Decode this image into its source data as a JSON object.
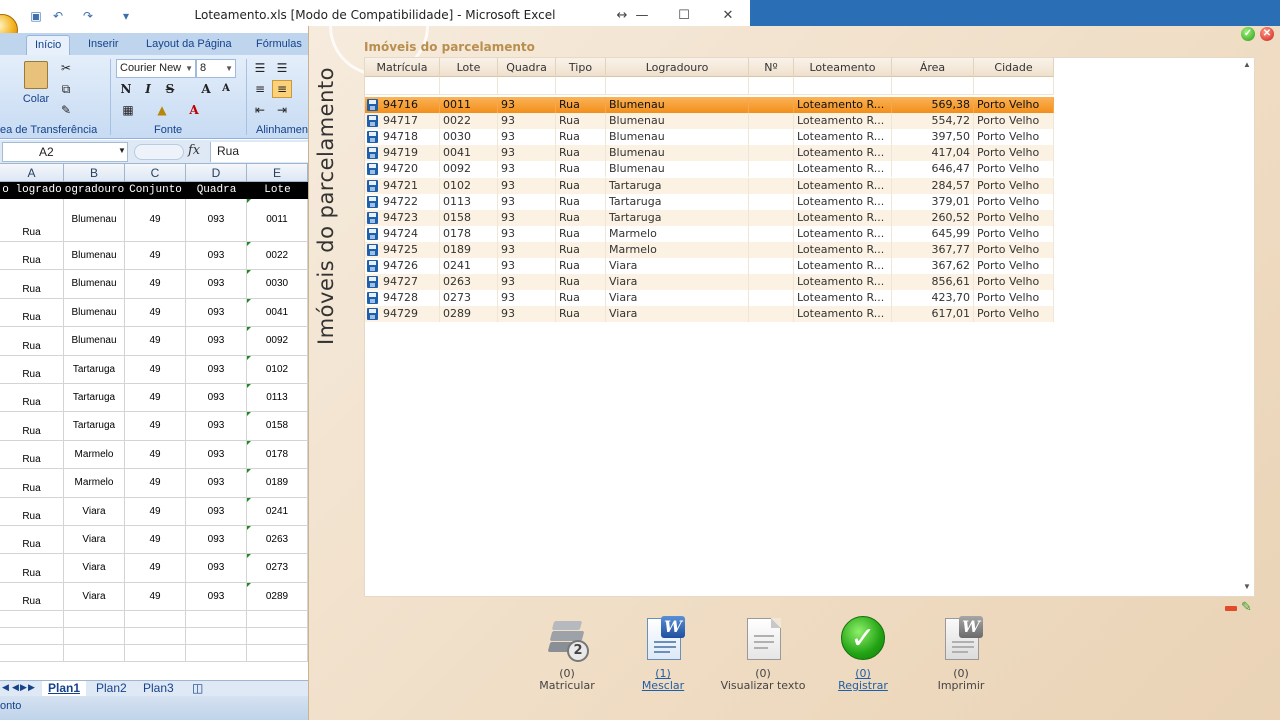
{
  "colors": {
    "accent_orange": "#f28f1b",
    "dialog_bg": "#f6ebdd",
    "excel_ribbon": "#c7dbf3",
    "panel_title": "#b98e4e",
    "link_blue": "#1f5ea8"
  },
  "excel": {
    "title": "Loteamento.xls  [Modo de Compatibilidade] - Microsoft Excel",
    "tabs": [
      "Início",
      "Inserir",
      "Layout da Página",
      "Fórmulas"
    ],
    "ribbon": {
      "paste_label": "Colar",
      "font_name": "Courier New",
      "font_size": "8",
      "bold": "N",
      "italic": "I",
      "strike": "S",
      "grow_font": "A",
      "shrink_font": "A",
      "group_clipboard": "ea de Transferência",
      "group_font": "Fonte",
      "group_alignment": "Alinhamen"
    },
    "name_box": "A2",
    "fx": "fx",
    "formula_value": "Rua",
    "columns": [
      "A",
      "B",
      "C",
      "D",
      "E"
    ],
    "header_row": [
      "o logrado",
      "ogradouro",
      "Conjunto",
      "Quadra",
      "Lote"
    ],
    "rows": [
      {
        "a": "Rua",
        "b": "Blumenau",
        "c": "49",
        "d": "093",
        "e": "0011"
      },
      {
        "a": "Rua",
        "b": "Blumenau",
        "c": "49",
        "d": "093",
        "e": "0022"
      },
      {
        "a": "Rua",
        "b": "Blumenau",
        "c": "49",
        "d": "093",
        "e": "0030"
      },
      {
        "a": "Rua",
        "b": "Blumenau",
        "c": "49",
        "d": "093",
        "e": "0041"
      },
      {
        "a": "Rua",
        "b": "Blumenau",
        "c": "49",
        "d": "093",
        "e": "0092"
      },
      {
        "a": "Rua",
        "b": "Tartaruga",
        "c": "49",
        "d": "093",
        "e": "0102"
      },
      {
        "a": "Rua",
        "b": "Tartaruga",
        "c": "49",
        "d": "093",
        "e": "0113"
      },
      {
        "a": "Rua",
        "b": "Tartaruga",
        "c": "49",
        "d": "093",
        "e": "0158"
      },
      {
        "a": "Rua",
        "b": "Marmelo",
        "c": "49",
        "d": "093",
        "e": "0178"
      },
      {
        "a": "Rua",
        "b": "Marmelo",
        "c": "49",
        "d": "093",
        "e": "0189"
      },
      {
        "a": "Rua",
        "b": "Viara",
        "c": "49",
        "d": "093",
        "e": "0241"
      },
      {
        "a": "Rua",
        "b": "Viara",
        "c": "49",
        "d": "093",
        "e": "0263"
      },
      {
        "a": "Rua",
        "b": "Viara",
        "c": "49",
        "d": "093",
        "e": "0273"
      },
      {
        "a": "Rua",
        "b": "Viara",
        "c": "49",
        "d": "093",
        "e": "0289"
      }
    ],
    "sheet_tabs": [
      "Plan1",
      "Plan2",
      "Plan3"
    ],
    "active_sheet": "Plan1",
    "status": "onto"
  },
  "dialog": {
    "side_caption": "Imóveis do parcelamento",
    "panel_title": "Imóveis do parcelamento",
    "columns": [
      "Matrícula",
      "Lote",
      "Quadra",
      "Tipo",
      "Logradouro",
      "Nº",
      "Loteamento",
      "Área",
      "Cidade"
    ],
    "selected_index": 0,
    "rows": [
      {
        "matricula": "94716",
        "lote": "0011",
        "quadra": "93",
        "tipo": "Rua",
        "logradouro": "Blumenau",
        "numero": "",
        "loteamento": "Loteamento R...",
        "area": "569,38",
        "cidade": "Porto Velho"
      },
      {
        "matricula": "94717",
        "lote": "0022",
        "quadra": "93",
        "tipo": "Rua",
        "logradouro": "Blumenau",
        "numero": "",
        "loteamento": "Loteamento R...",
        "area": "554,72",
        "cidade": "Porto Velho"
      },
      {
        "matricula": "94718",
        "lote": "0030",
        "quadra": "93",
        "tipo": "Rua",
        "logradouro": "Blumenau",
        "numero": "",
        "loteamento": "Loteamento R...",
        "area": "397,50",
        "cidade": "Porto Velho"
      },
      {
        "matricula": "94719",
        "lote": "0041",
        "quadra": "93",
        "tipo": "Rua",
        "logradouro": "Blumenau",
        "numero": "",
        "loteamento": "Loteamento R...",
        "area": "417,04",
        "cidade": "Porto Velho"
      },
      {
        "matricula": "94720",
        "lote": "0092",
        "quadra": "93",
        "tipo": "Rua",
        "logradouro": "Blumenau",
        "numero": "",
        "loteamento": "Loteamento R...",
        "area": "646,47",
        "cidade": "Porto Velho"
      },
      {
        "matricula": "94721",
        "lote": "0102",
        "quadra": "93",
        "tipo": "Rua",
        "logradouro": "Tartaruga",
        "numero": "",
        "loteamento": "Loteamento R...",
        "area": "284,57",
        "cidade": "Porto Velho"
      },
      {
        "matricula": "94722",
        "lote": "0113",
        "quadra": "93",
        "tipo": "Rua",
        "logradouro": "Tartaruga",
        "numero": "",
        "loteamento": "Loteamento R...",
        "area": "379,01",
        "cidade": "Porto Velho"
      },
      {
        "matricula": "94723",
        "lote": "0158",
        "quadra": "93",
        "tipo": "Rua",
        "logradouro": "Tartaruga",
        "numero": "",
        "loteamento": "Loteamento R...",
        "area": "260,52",
        "cidade": "Porto Velho"
      },
      {
        "matricula": "94724",
        "lote": "0178",
        "quadra": "93",
        "tipo": "Rua",
        "logradouro": "Marmelo",
        "numero": "",
        "loteamento": "Loteamento R...",
        "area": "645,99",
        "cidade": "Porto Velho"
      },
      {
        "matricula": "94725",
        "lote": "0189",
        "quadra": "93",
        "tipo": "Rua",
        "logradouro": "Marmelo",
        "numero": "",
        "loteamento": "Loteamento R...",
        "area": "367,77",
        "cidade": "Porto Velho"
      },
      {
        "matricula": "94726",
        "lote": "0241",
        "quadra": "93",
        "tipo": "Rua",
        "logradouro": "Viara",
        "numero": "",
        "loteamento": "Loteamento R...",
        "area": "367,62",
        "cidade": "Porto Velho"
      },
      {
        "matricula": "94727",
        "lote": "0263",
        "quadra": "93",
        "tipo": "Rua",
        "logradouro": "Viara",
        "numero": "",
        "loteamento": "Loteamento R...",
        "area": "856,61",
        "cidade": "Porto Velho"
      },
      {
        "matricula": "94728",
        "lote": "0273",
        "quadra": "93",
        "tipo": "Rua",
        "logradouro": "Viara",
        "numero": "",
        "loteamento": "Loteamento R...",
        "area": "423,70",
        "cidade": "Porto Velho"
      },
      {
        "matricula": "94729",
        "lote": "0289",
        "quadra": "93",
        "tipo": "Rua",
        "logradouro": "Viara",
        "numero": "",
        "loteamento": "Loteamento R...",
        "area": "617,01",
        "cidade": "Porto Velho"
      }
    ],
    "actions": [
      {
        "name": "matricular",
        "icon": "books-icon",
        "count": "(0)",
        "label": "Matricular",
        "link": false
      },
      {
        "name": "mesclar",
        "icon": "word-document-icon",
        "count": "(1)",
        "label": "Mesclar",
        "link": true
      },
      {
        "name": "visualizar-texto",
        "icon": "document-icon",
        "count": "(0)",
        "label": "Visualizar texto",
        "link": false
      },
      {
        "name": "registrar",
        "icon": "check-icon",
        "count": "(0)",
        "label": "Registrar",
        "link": true
      },
      {
        "name": "imprimir",
        "icon": "print-document-icon",
        "count": "(0)",
        "label": "Imprimir",
        "link": false
      }
    ]
  }
}
